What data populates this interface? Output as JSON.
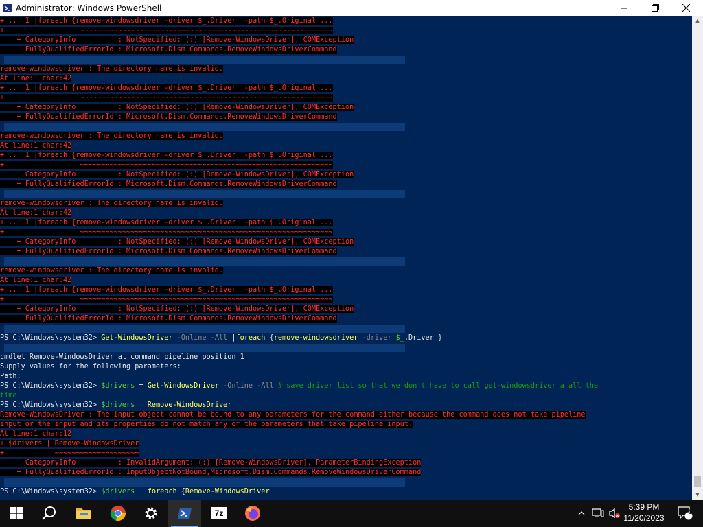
{
  "window": {
    "title": "Administrator: Windows PowerShell",
    "controls": {
      "minimize": "—",
      "maximize": "❐",
      "close": "✕"
    }
  },
  "console": {
    "lines": [
      [
        {
          "t": "+ ... 1 |foreach {remove-windowsdriver -driver $_.Driver  -path $_.Original ...",
          "c": "err"
        }
      ],
      [
        {
          "t": "+                  ~~~~~~~~~~~~~~~~~~~~~~~~~~~~~~~~~~~~~~~~~~~~~~~~~~~~~~~~~~~~",
          "c": "err"
        }
      ],
      [
        {
          "t": "    + CategoryInfo          : NotSpecified: (:) [Remove-WindowsDriver], COMException",
          "c": "err"
        }
      ],
      [
        {
          "t": "    + FullyQualifiedErrorId : Microsoft.Dism.Commands.RemoveWindowsDriverCommand",
          "c": "err"
        }
      ],
      [],
      [
        {
          "t": "remove-windowsdriver : The directory name is invalid.",
          "c": "err"
        }
      ],
      [
        {
          "t": "At line:1 char:42",
          "c": "err"
        }
      ],
      [
        {
          "t": "+ ... 1 |foreach {remove-windowsdriver -driver $_.Driver  -path $_.Original ...",
          "c": "err"
        }
      ],
      [
        {
          "t": "+                  ~~~~~~~~~~~~~~~~~~~~~~~~~~~~~~~~~~~~~~~~~~~~~~~~~~~~~~~~~~~~",
          "c": "err"
        }
      ],
      [
        {
          "t": "    + CategoryInfo          : NotSpecified: (:) [Remove-WindowsDriver], COMException",
          "c": "err"
        }
      ],
      [
        {
          "t": "    + FullyQualifiedErrorId : Microsoft.Dism.Commands.RemoveWindowsDriverCommand",
          "c": "err"
        }
      ],
      [],
      [
        {
          "t": "remove-windowsdriver : The directory name is invalid.",
          "c": "err"
        }
      ],
      [
        {
          "t": "At line:1 char:42",
          "c": "err"
        }
      ],
      [
        {
          "t": "+ ... 1 |foreach {remove-windowsdriver -driver $_.Driver  -path $_.Original ...",
          "c": "err"
        }
      ],
      [
        {
          "t": "+                  ~~~~~~~~~~~~~~~~~~~~~~~~~~~~~~~~~~~~~~~~~~~~~~~~~~~~~~~~~~~~",
          "c": "err"
        }
      ],
      [
        {
          "t": "    + CategoryInfo          : NotSpecified: (:) [Remove-WindowsDriver], COMException",
          "c": "err"
        }
      ],
      [
        {
          "t": "    + FullyQualifiedErrorId : Microsoft.Dism.Commands.RemoveWindowsDriverCommand",
          "c": "err"
        }
      ],
      [],
      [
        {
          "t": "remove-windowsdriver : The directory name is invalid.",
          "c": "err"
        }
      ],
      [
        {
          "t": "At line:1 char:42",
          "c": "err"
        }
      ],
      [
        {
          "t": "+ ... 1 |foreach {remove-windowsdriver -driver $_.Driver  -path $_.Original ...",
          "c": "err"
        }
      ],
      [
        {
          "t": "+                  ~~~~~~~~~~~~~~~~~~~~~~~~~~~~~~~~~~~~~~~~~~~~~~~~~~~~~~~~~~~~",
          "c": "err"
        }
      ],
      [
        {
          "t": "    + CategoryInfo          : NotSpecified: (:) [Remove-WindowsDriver], COMException",
          "c": "err"
        }
      ],
      [
        {
          "t": "    + FullyQualifiedErrorId : Microsoft.Dism.Commands.RemoveWindowsDriverCommand",
          "c": "err"
        }
      ],
      [],
      [
        {
          "t": "remove-windowsdriver : The directory name is invalid.",
          "c": "err"
        }
      ],
      [
        {
          "t": "At line:1 char:42",
          "c": "err"
        }
      ],
      [
        {
          "t": "+ ... 1 |foreach {remove-windowsdriver -driver $_.Driver  -path $_.Original ...",
          "c": "err"
        }
      ],
      [
        {
          "t": "+                  ~~~~~~~~~~~~~~~~~~~~~~~~~~~~~~~~~~~~~~~~~~~~~~~~~~~~~~~~~~~~",
          "c": "err"
        }
      ],
      [
        {
          "t": "    + CategoryInfo          : NotSpecified: (:) [Remove-WindowsDriver], COMException",
          "c": "err"
        }
      ],
      [
        {
          "t": "    + FullyQualifiedErrorId : Microsoft.Dism.Commands.RemoveWindowsDriverCommand",
          "c": "err"
        }
      ],
      [],
      [
        {
          "t": "PS C:\\Windows\\system32> ",
          "c": "wht"
        },
        {
          "t": "Get-WindowsDriver",
          "c": "cmd"
        },
        {
          "t": " -Online -All ",
          "c": "param"
        },
        {
          "t": "|",
          "c": "wht"
        },
        {
          "t": "foreach",
          "c": "cmd"
        },
        {
          "t": " {",
          "c": "wht"
        },
        {
          "t": "remove-windowsdriver",
          "c": "cmd"
        },
        {
          "t": " -driver ",
          "c": "param"
        },
        {
          "t": "$_",
          "c": "var"
        },
        {
          "t": ".Driver }",
          "c": "wht"
        }
      ],
      [],
      [
        {
          "t": "cmdlet Remove-WindowsDriver at command pipeline position 1",
          "c": "wht"
        }
      ],
      [
        {
          "t": "Supply values for the following parameters:",
          "c": "wht"
        }
      ],
      [
        {
          "t": "Path:",
          "c": "wht"
        }
      ],
      [
        {
          "t": "PS C:\\Windows\\system32> ",
          "c": "wht"
        },
        {
          "t": "$drivers",
          "c": "var"
        },
        {
          "t": " = ",
          "c": "wht"
        },
        {
          "t": "Get-WindowsDriver",
          "c": "cmd"
        },
        {
          "t": " -Online -All ",
          "c": "param"
        },
        {
          "t": "# save driver list so that we don't have to call get-windowsdriver a all the",
          "c": "cmt"
        }
      ],
      [
        {
          "t": "time",
          "c": "cmt"
        }
      ],
      [
        {
          "t": "PS C:\\Windows\\system32> ",
          "c": "wht"
        },
        {
          "t": "$drivers",
          "c": "var"
        },
        {
          "t": " | ",
          "c": "wht"
        },
        {
          "t": "Remove-WindowsDriver",
          "c": "cmd"
        }
      ],
      [
        {
          "t": "Remove-WindowsDriver : The input object cannot be bound to any parameters for the command either because the command does not take pipeline",
          "c": "err"
        }
      ],
      [
        {
          "t": "input or the input and its properties do not match any of the parameters that take pipeline input.",
          "c": "err"
        }
      ],
      [
        {
          "t": "At line:1 char:12",
          "c": "err"
        }
      ],
      [
        {
          "t": "+ $drivers | Remove-WindowsDriver",
          "c": "err"
        }
      ],
      [
        {
          "t": "+            ~~~~~~~~~~~~~~~~~~~~",
          "c": "err"
        }
      ],
      [
        {
          "t": "    + CategoryInfo          : InvalidArgument: (:) [Remove-WindowsDriver], ParameterBindingException",
          "c": "err"
        }
      ],
      [
        {
          "t": "    + FullyQualifiedErrorId : InputObjectNotBound,Microsoft.Dism.Commands.RemoveWindowsDriverCommand",
          "c": "err"
        }
      ],
      [],
      [
        {
          "t": "PS C:\\Windows\\system32> ",
          "c": "wht"
        },
        {
          "t": "$drivers",
          "c": "var"
        },
        {
          "t": " | ",
          "c": "wht"
        },
        {
          "t": "foreach",
          "c": "cmd"
        },
        {
          "t": " {",
          "c": "wht"
        },
        {
          "t": "Remove-WindowsDriver",
          "c": "cmd"
        }
      ]
    ],
    "colors": {
      "background": "#012456",
      "error": "#ff2f2f",
      "command": "#ffff55",
      "parameter": "#8a8a8a",
      "comment": "#13a10e",
      "variable": "#59d32a",
      "text": "#e6e6e6"
    }
  },
  "taskbar": {
    "items": [
      {
        "name": "start-button",
        "icon": "windows-logo-icon"
      },
      {
        "name": "search-button",
        "icon": "search-icon"
      },
      {
        "name": "file-explorer-button",
        "icon": "folder-icon"
      },
      {
        "name": "chrome-button",
        "icon": "chrome-icon"
      },
      {
        "name": "settings-button",
        "icon": "gear-icon"
      },
      {
        "name": "powershell-button",
        "icon": "powershell-icon"
      },
      {
        "name": "7zip-button",
        "icon": "7zip-icon",
        "label": "7z"
      },
      {
        "name": "firefox-button",
        "icon": "firefox-icon"
      }
    ],
    "clock": {
      "time": "5:39 PM",
      "date": "11/20/2023"
    },
    "notification_count": "1"
  }
}
